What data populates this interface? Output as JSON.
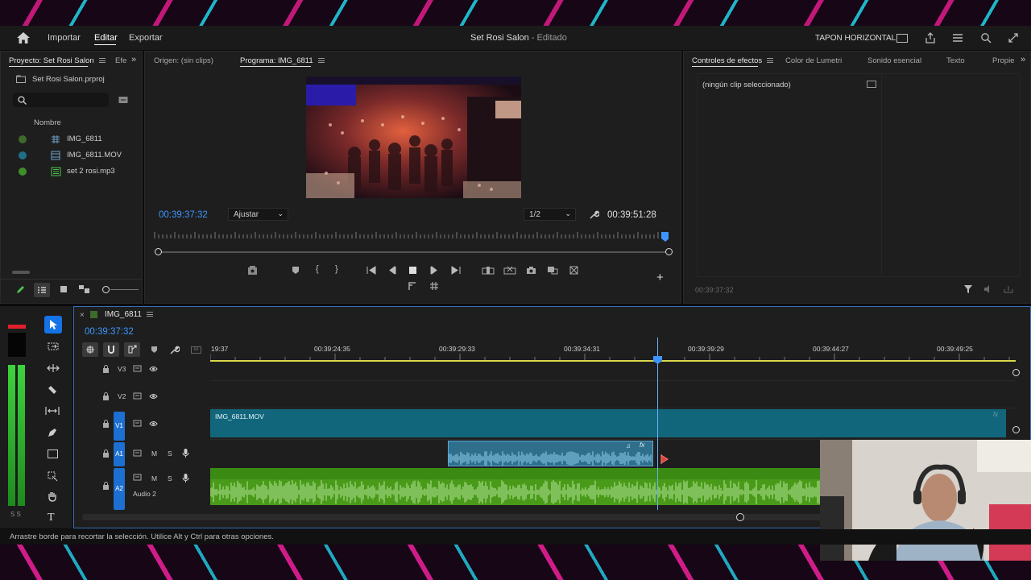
{
  "menu": {
    "home_label": "",
    "items": [
      "Importar",
      "Editar",
      "Exportar"
    ],
    "active_index": 1,
    "title_project": "Set Rosi Salon",
    "title_sep": " - ",
    "title_status": "Editado",
    "workspace": "TAPON HORIZONTAL"
  },
  "project_panel": {
    "tab_label": "Proyecto: Set Rosi Salon",
    "tab2_label": "Efe",
    "file_name": "Set Rosi Salon.prproj",
    "search_placeholder": "",
    "column_name": "Nombre",
    "items": [
      {
        "name": "IMG_6811",
        "color": "#3e6b2a"
      },
      {
        "name": "IMG_6811.MOV",
        "color": "#1f6f87"
      },
      {
        "name": "set 2 rosi.mp3",
        "color": "#3e8f2a"
      }
    ]
  },
  "source_panel": {
    "tab_label": "Origen: (sin clips)"
  },
  "program_panel": {
    "tab_label": "Programa: IMG_6811",
    "timecode_current": "00:39:37:32",
    "fit_option": "Ajustar",
    "resolution_option": "1/2",
    "timecode_duration": "00:39:51:28"
  },
  "effects_panel": {
    "tabs": [
      "Controles de efectos",
      "Color de Lumetri",
      "Sonido esencial",
      "Texto",
      "Propie"
    ],
    "no_clip": "(ningún clip seleccionado)",
    "footer_timecode": "00:39:37:32"
  },
  "timeline": {
    "tab_label": "IMG_6811",
    "timecode": "00:39:37:32",
    "ruler_labels": [
      "19:37",
      "00:39:24:35",
      "00:39:29:33",
      "00:39:34:31",
      "00:39:39:29",
      "00:39:44:27",
      "00:39:49:25"
    ],
    "tracks": {
      "v3": "V3",
      "v2": "V2",
      "v1": "V1",
      "a1": "A1",
      "a2": "A2",
      "audio2_name": "Audio 2",
      "m": "M",
      "s": "S"
    },
    "clip_video": "IMG_6811.MOV",
    "clip_fx": "fx"
  },
  "meter": {
    "label": "S S"
  },
  "status_bar": "Arrastre borde para recortar la selección. Utilice Alt y Ctrl para otras opciones.",
  "colors": {
    "accent": "#3d96ff",
    "video_clip": "#12667c",
    "audio_clip_a1": "#3a8fc0",
    "audio_clip_a2": "#4a9a1a",
    "playhead": "#6aaef5",
    "work_area": "#d8d84a"
  }
}
